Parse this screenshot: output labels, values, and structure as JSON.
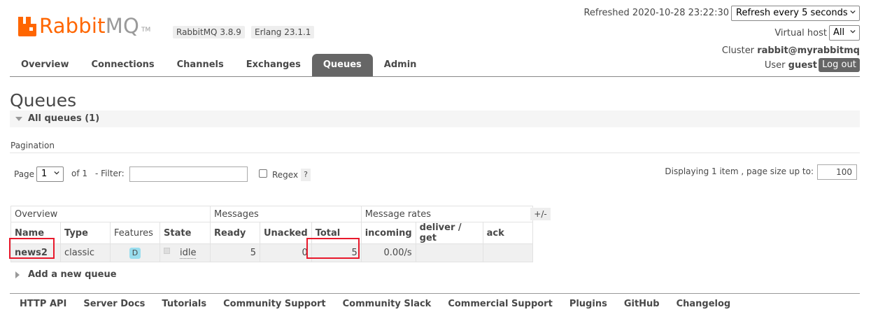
{
  "header": {
    "logo_word_left": "Rabbit",
    "logo_word_right": "MQ",
    "logo_tm": "TM",
    "version_badge": "RabbitMQ 3.8.9",
    "erlang_badge": "Erlang 23.1.1",
    "refreshed_text": "Refreshed 2020-10-28 23:22:30",
    "refresh_select_value": "Refresh every 5 seconds",
    "virtual_host_label": "Virtual host",
    "virtual_host_value": "All",
    "cluster_label": "Cluster",
    "cluster_value": "rabbit@myrabbitmq",
    "user_label": "User",
    "user_value": "guest",
    "logout_label": "Log out"
  },
  "nav": {
    "tabs": [
      {
        "label": "Overview",
        "active": false
      },
      {
        "label": "Connections",
        "active": false
      },
      {
        "label": "Channels",
        "active": false
      },
      {
        "label": "Exchanges",
        "active": false
      },
      {
        "label": "Queues",
        "active": true
      },
      {
        "label": "Admin",
        "active": false
      }
    ]
  },
  "page": {
    "title": "Queues",
    "section_title": "All queues (1)",
    "pagination_label": "Pagination",
    "page_label": "Page",
    "page_value": "1",
    "of_label": "of 1",
    "filter_label": "- Filter:",
    "filter_value": "",
    "regex_label": "Regex",
    "regex_help": "?",
    "displaying_label": "Displaying 1 item , page size up to:",
    "page_size_value": "100"
  },
  "table": {
    "group_headers": [
      "Overview",
      "Messages",
      "Message rates"
    ],
    "plus_minus": "+/-",
    "columns": [
      "Name",
      "Type",
      "Features",
      "State",
      "Ready",
      "Unacked",
      "Total",
      "incoming",
      "deliver / get",
      "ack"
    ],
    "rows": [
      {
        "name": "news2",
        "type": "classic",
        "features": "D",
        "state": "idle",
        "ready": "5",
        "unacked": "0",
        "total": "5",
        "incoming": "0.00/s",
        "deliver_get": "",
        "ack": ""
      }
    ]
  },
  "add_queue_label": "Add a new queue",
  "footer": {
    "links": [
      "HTTP API",
      "Server Docs",
      "Tutorials",
      "Community Support",
      "Community Slack",
      "Commercial Support",
      "Plugins",
      "GitHub",
      "Changelog"
    ]
  },
  "colors": {
    "brand": "#ff6600",
    "tab_active": "#666666",
    "highlight": "#e8192c"
  }
}
